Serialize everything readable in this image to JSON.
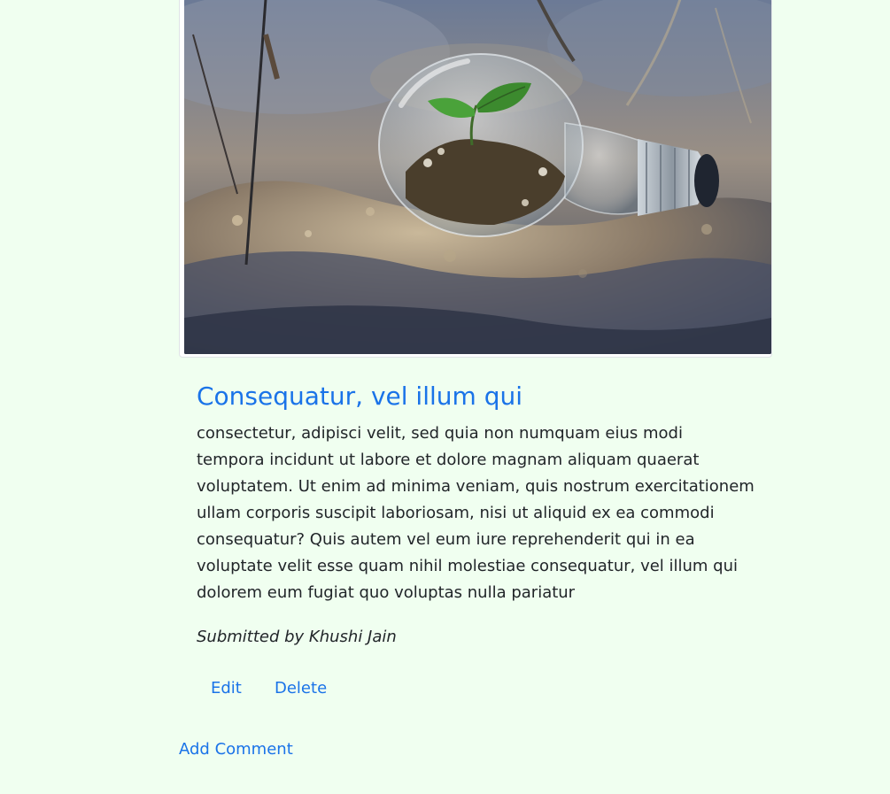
{
  "post": {
    "image": {
      "alt_concept": "lightbulb-with-seedling-photo"
    },
    "title": "Consequatur, vel illum qui",
    "body": "consectetur, adipisci velit, sed quia non numquam eius modi tempora incidunt ut labore et dolore magnam aliquam quaerat voluptatem. Ut enim ad minima veniam, quis nostrum exercitationem ullam corporis suscipit laboriosam, nisi ut aliquid ex ea commodi consequatur? Quis autem vel eum iure reprehenderit qui in ea voluptate velit esse quam nihil molestiae consequatur, vel illum qui dolorem eum fugiat quo voluptas nulla pariatur",
    "submitted_by": "Submitted by Khushi Jain"
  },
  "actions": {
    "edit_label": "Edit",
    "delete_label": "Delete"
  },
  "comments": {
    "add_label": "Add Comment"
  },
  "colors": {
    "page_background": "#f0fff0",
    "link": "#1a73e8",
    "text": "#212529"
  }
}
